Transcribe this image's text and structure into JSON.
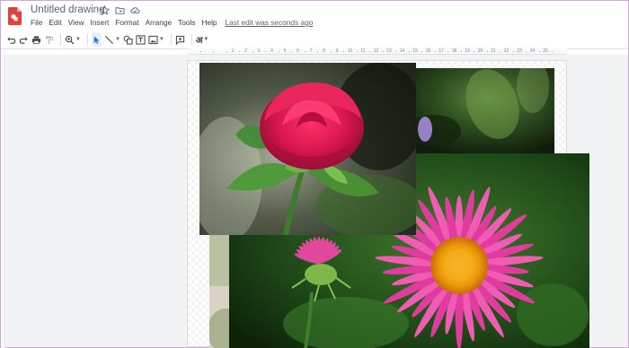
{
  "header": {
    "title": "Untitled drawing",
    "icons": [
      "star-icon",
      "move-to-folder-icon",
      "cloud-saved-icon"
    ]
  },
  "menu": {
    "items": [
      "File",
      "Edit",
      "View",
      "Insert",
      "Format",
      "Arrange",
      "Tools",
      "Help"
    ],
    "last_edit": "Last edit was seconds ago"
  },
  "toolbar": {
    "buttons": [
      "undo-icon",
      "redo-icon",
      "print-icon",
      "paint-format-icon",
      "zoom-icon",
      "select-icon",
      "line-icon",
      "shape-icon",
      "text-box-icon",
      "image-icon",
      "comment-icon",
      "input-tools-icon"
    ],
    "input_tools_glyph": "अ"
  },
  "ruler": {
    "labels": [
      "1",
      "2",
      "3",
      "4",
      "5",
      "6",
      "7",
      "8",
      "9",
      "10",
      "11",
      "12",
      "13",
      "14",
      "15",
      "16",
      "17",
      "18",
      "19",
      "20",
      "21",
      "22",
      "23",
      "24",
      "25"
    ]
  },
  "canvas": {
    "images": [
      {
        "name": "dark-leaves-photo"
      },
      {
        "name": "blurred-flower-photo"
      },
      {
        "name": "pink-aster-photo"
      },
      {
        "name": "red-rose-photo"
      }
    ]
  },
  "colors": {
    "accent": "#1a73e8",
    "rose": "#d8174f",
    "aster": "#e23ba0",
    "aster_center": "#f2a20c",
    "foliage": "#2f5a2a"
  }
}
